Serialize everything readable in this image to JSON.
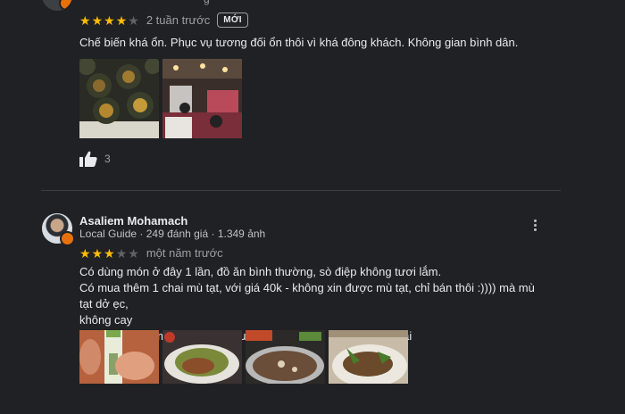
{
  "review1": {
    "author_partial": "g",
    "rating": 4,
    "time": "2 tuần trước",
    "new_badge": "MỚI",
    "text": "Chế biến khá ổn. Phục vụ tương đối ổn thôi vì khá đông khách. Không gian bình dân.",
    "photos": [
      "sea-urchin-dish-photo",
      "restaurant-interior-photo"
    ],
    "likes": "3"
  },
  "review2": {
    "author": "Asaliem Mohamach",
    "local_guide": "Local Guide",
    "review_count": "249 đánh giá",
    "photo_count": "1.349 ảnh",
    "rating": 3,
    "time": "một năm trước",
    "text_lines": [
      "Có dùng món ở đây 1 lần, đồ ăn bình thường, sò điệp không tươi lắm.",
      "Có mua thêm 1 chai mù tạt, với giá 40k - không xin được mù tạt, chỉ bán thôi :)))) mà mù tạt dở ẹc,",
      "không cay",
      "Lần đầu dùng món thôi, nếu sau thay đổi phong cách sẽ quay lại"
    ],
    "photos": [
      "wasabi-bottle-photo",
      "stir-fry-dish-photo",
      "hotpot-photo",
      "seafood-plate-photo"
    ]
  },
  "colors": {
    "background": "#202124",
    "star": "#fbbc04",
    "star_empty": "#5f6368",
    "badge": "#e8710a"
  }
}
